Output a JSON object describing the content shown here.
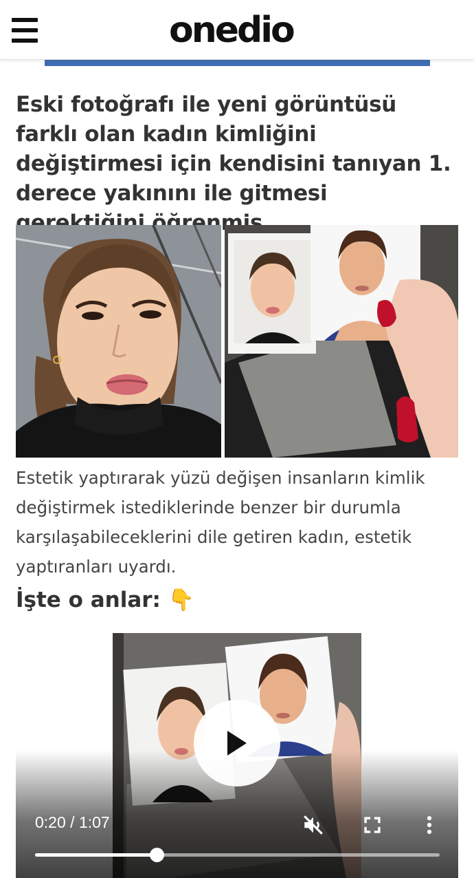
{
  "header": {
    "logo": "onedio",
    "menu_icon": "hamburger-menu-icon"
  },
  "article": {
    "headline": "Eski fotoğrafı ile yeni görüntüsü farklı olan kadın kimliğini değiştirmesi için kendisini tanıyan 1. derece yakınını ile gitmesi gerektiğini öğrenmiş.",
    "caption": "Estetik yaptırarak yüzü değişen insanların kimlik değiştirmek istediklerinde benzer bir durumla karşılaşabileceklerini dile getiren kadın, estetik yaptıranları uyardı.",
    "subheading": "İşte o anlar: 👇"
  },
  "video": {
    "current_time": "0:20",
    "separator": "/",
    "duration": "1:07",
    "progress_fraction": 0.3,
    "icons": [
      "play-icon",
      "mute-icon",
      "fullscreen-icon",
      "more-options-icon"
    ]
  },
  "colors": {
    "ad_strip": "#3f6db3",
    "text": "#333333",
    "nail_red": "#c0102a"
  }
}
